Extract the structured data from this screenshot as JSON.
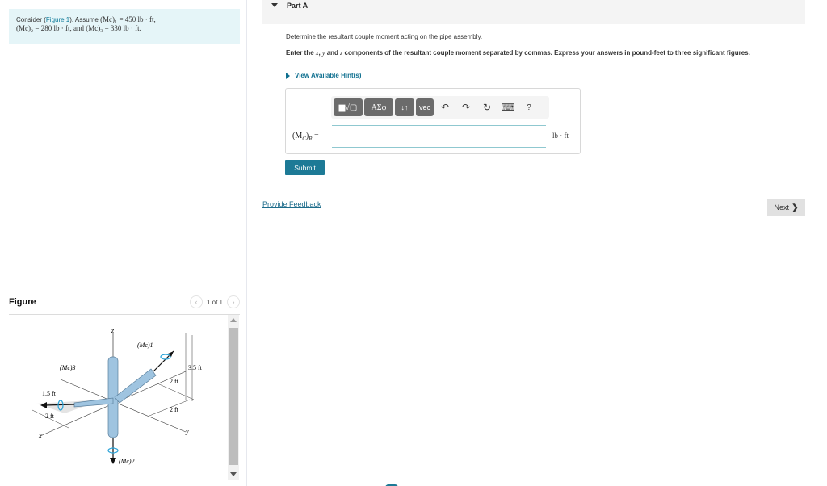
{
  "problem": {
    "prefix": "Consider (",
    "figure_link": "Figure 1",
    "after_link": "). Assume ",
    "m1": "(Mc)₁ = 450 lb · ft,",
    "m2": "(Mc)₂ = 280 lb · ft, and (Mc)₃ = 330 lb · ft."
  },
  "figure": {
    "title": "Figure",
    "counter": "1 of 1",
    "prev_icon": "chevron-left-icon",
    "next_icon": "chevron-right-icon",
    "labels": {
      "z": "z",
      "x": "x",
      "y": "y",
      "m1": "(Mc)1",
      "m2": "(Mc)2",
      "m3": "(Mc)3",
      "d1": "1.5 ft",
      "d2": "2 ft",
      "d3": "2 ft",
      "d4": "2 ft",
      "d5": "3.5 ft"
    }
  },
  "part": {
    "title": "Part A",
    "question": "Determine the resultant couple moment acting on the pipe assembly.",
    "instruction_prefix": "Enter the ",
    "instruction_x": "x",
    "instruction_mid1": ", ",
    "instruction_y": "y",
    "instruction_mid2": " and ",
    "instruction_z": "z",
    "instruction_suffix": " components of the resultant couple moment separated by commas. Express your answers in pound-feet to three significant figures.",
    "hint_label": "View Available Hint(s)"
  },
  "answer": {
    "label_main": "(M",
    "label_sub": "C",
    "label_close": ")",
    "label_sub2": "R",
    "label_eq": " =",
    "value": "",
    "unit": "lb · ft",
    "toolbar": {
      "templates": "▆√▢",
      "symbols": "ΑΣφ",
      "updown": "↓↑",
      "vec": "vec",
      "undo": "↶",
      "redo": "↷",
      "reset": "↻",
      "keyboard": "⌨",
      "help": "?"
    }
  },
  "buttons": {
    "submit": "Submit",
    "feedback": "Provide Feedback",
    "next": "Next",
    "next_chevron": "❯"
  }
}
